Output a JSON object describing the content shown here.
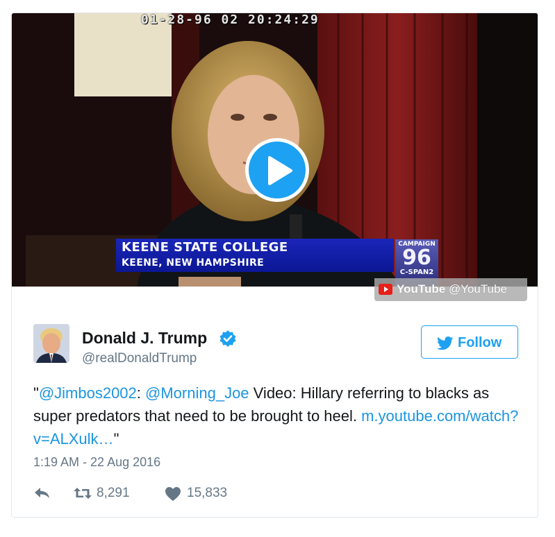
{
  "media": {
    "timecode": "01-28-96 02 20:24:29",
    "caption_line1": "KEENE STATE COLLEGE",
    "caption_line2": "KEENE, NEW HAMPSHIRE",
    "campaign_top": "CAMPAIGN",
    "campaign_year": "96",
    "campaign_network": "C-SPAN2",
    "source_name": "YouTube",
    "source_handle": "@YouTube",
    "play_color": "#1da1f2"
  },
  "tweet": {
    "display_name": "Donald J. Trump",
    "handle": "@realDonaldTrump",
    "follow_label": "Follow",
    "text": {
      "open_quote": "\"",
      "mention1": "@Jimbos2002",
      "sep": ": ",
      "mention2": "@Morning_Joe",
      "body": " Video: Hillary referring to blacks as super predators that need to be brought to heel. ",
      "link": "m.youtube.com/watch?v=ALXulk…",
      "close_quote": "\""
    },
    "timestamp": "1:19 AM - 22 Aug 2016",
    "retweets": "8,291",
    "likes": "15,833"
  },
  "icons": [
    "play-icon",
    "youtube-icon",
    "verified-icon",
    "twitter-bird-icon",
    "reply-icon",
    "retweet-icon",
    "heart-icon"
  ],
  "colors": {
    "link": "#1b95e0",
    "accent": "#1da1f2",
    "muted": "#657786",
    "text": "#14171a"
  }
}
